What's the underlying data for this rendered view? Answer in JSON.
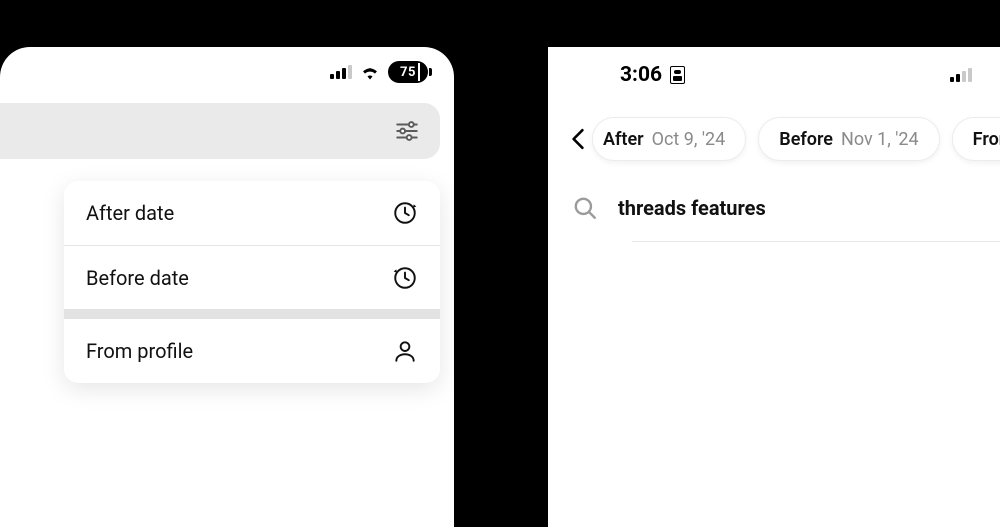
{
  "left": {
    "battery_pct": "75",
    "filter_menu": {
      "after_label": "After date",
      "before_label": "Before date",
      "profile_label": "From profile"
    }
  },
  "right": {
    "time": "3:06",
    "chips": {
      "after": {
        "key": "After",
        "value": "Oct 9, '24"
      },
      "before": {
        "key": "Before",
        "value": "Nov 1, '24"
      },
      "from": {
        "key": "From"
      }
    },
    "search_query": "threads features"
  }
}
